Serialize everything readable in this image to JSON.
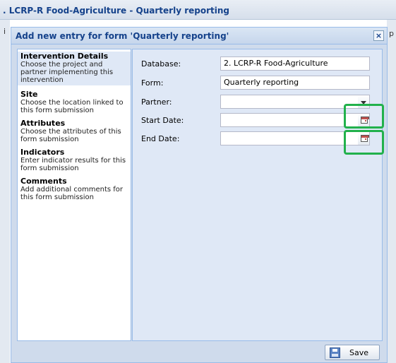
{
  "background": {
    "title": ". LCRP-R Food-Agriculture - Quarterly reporting",
    "left_glyph": "i",
    "right_glyph": "p"
  },
  "dialog": {
    "title": "Add new entry for form 'Quarterly reporting'",
    "close_glyph": "×"
  },
  "nav": {
    "items": [
      {
        "title": "Intervention Details",
        "desc": "Choose the project and partner implementing this intervention"
      },
      {
        "title": "Site",
        "desc": "Choose the location linked to this form submission"
      },
      {
        "title": "Attributes",
        "desc": "Choose the attributes of this form submission"
      },
      {
        "title": "Indicators",
        "desc": "Enter indicator results for this form submission"
      },
      {
        "title": "Comments",
        "desc": "Add additional comments for this form submission"
      }
    ]
  },
  "form": {
    "database_label": "Database:",
    "database_value": "2. LCRP-R Food-Agriculture",
    "form_label": "Form:",
    "form_value": "Quarterly reporting",
    "partner_label": "Partner:",
    "partner_value": "",
    "start_label": "Start Date:",
    "start_value": "",
    "end_label": "End Date:",
    "end_value": ""
  },
  "footer": {
    "save_label": "Save"
  },
  "colors": {
    "highlight": "#22b14c",
    "title_text": "#15428b",
    "panel_bg": "#dfe8f6"
  }
}
